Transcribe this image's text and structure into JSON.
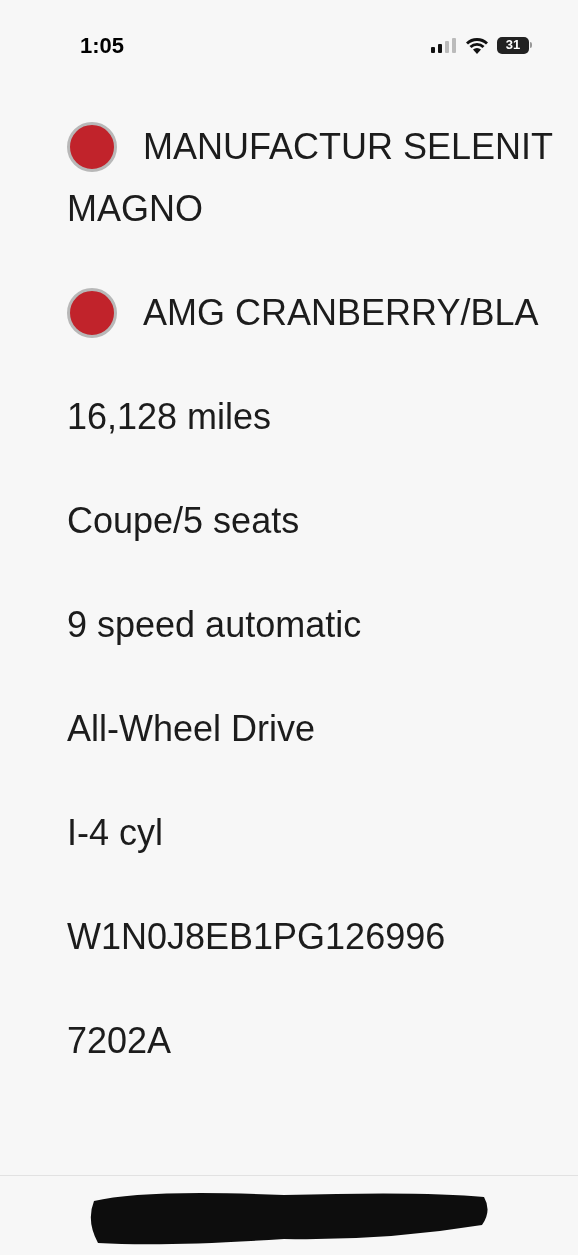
{
  "status_bar": {
    "time": "1:05",
    "battery": "31"
  },
  "colors": [
    {
      "lines": [
        "MANUFACTUR SELENIT",
        "MAGNO"
      ],
      "color": "#c1232b"
    },
    {
      "lines": [
        "AMG CRANBERRY/BLA"
      ],
      "color": "#c1232b"
    }
  ],
  "specs": [
    "16,128 miles",
    "Coupe/5 seats",
    "9 speed automatic",
    "All-Wheel Drive",
    "I-4 cyl",
    "W1N0J8EB1PG126996",
    "7202A"
  ]
}
